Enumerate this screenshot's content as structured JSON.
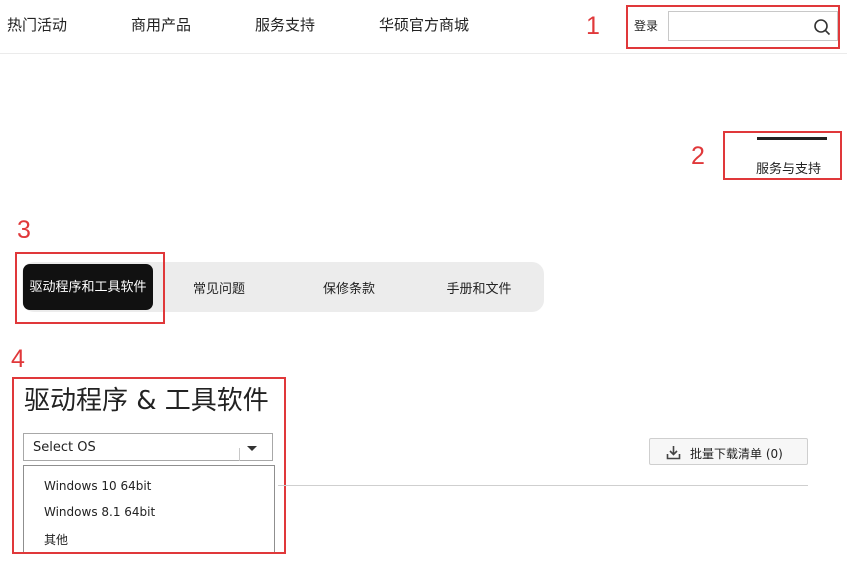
{
  "nav": {
    "items": [
      "热门活动",
      "商用产品",
      "服务支持",
      "华硕官方商城"
    ],
    "login_label": "登录",
    "search_value": "",
    "search_icon": "search-icon"
  },
  "annotations": [
    "1",
    "2",
    "3",
    "4"
  ],
  "service": {
    "label": "服务与支持"
  },
  "tabs": [
    {
      "label": "驱动程序和工具软件",
      "active": true
    },
    {
      "label": "常见问题",
      "active": false
    },
    {
      "label": "保修条款",
      "active": false
    },
    {
      "label": "手册和文件",
      "active": false
    }
  ],
  "section": {
    "title": "驱动程序 & 工具软件"
  },
  "os_select": {
    "value": "Select OS",
    "options": [
      "Windows 10 64bit",
      "Windows 8.1 64bit",
      "其他"
    ]
  },
  "batch_download": {
    "label": "批量下载清单 (0)",
    "icon": "download-icon"
  },
  "colors": {
    "annotation": "#e0383a",
    "active_tab_bg": "#111111",
    "tabs_bg": "#ececec"
  }
}
